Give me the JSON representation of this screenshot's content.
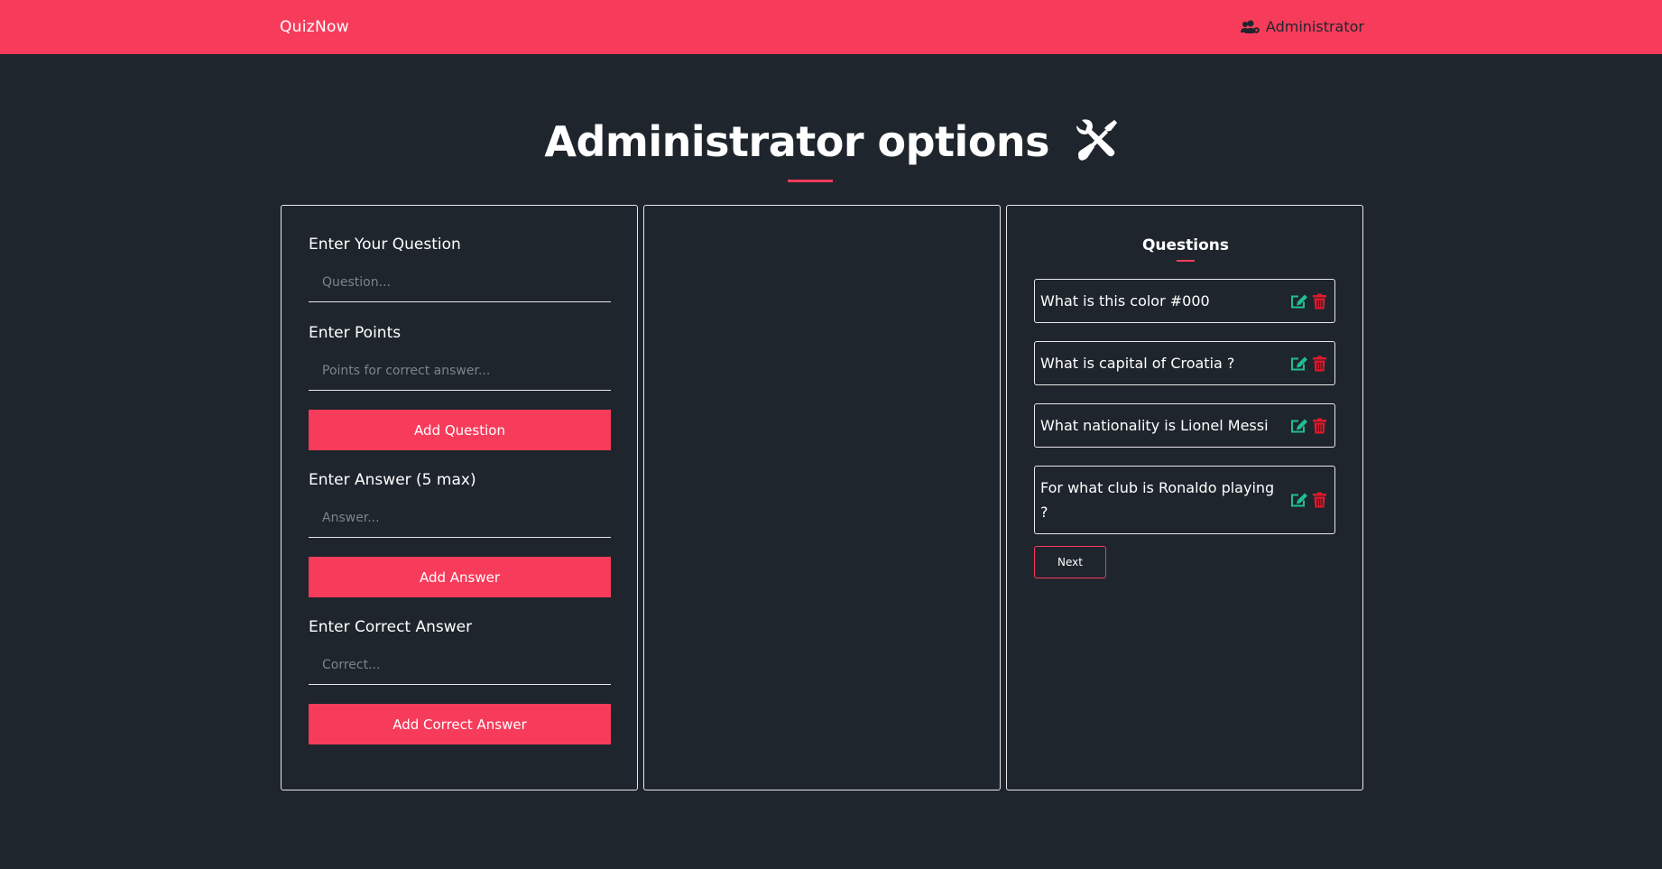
{
  "nav": {
    "brand": "QuizNow",
    "admin_label": "Administrator"
  },
  "page": {
    "title": "Administrator options"
  },
  "form": {
    "question_label": "Enter Your Question",
    "question_placeholder": "Question...",
    "points_label": "Enter Points",
    "points_placeholder": "Points for correct answer...",
    "add_question_label": "Add Question",
    "answer_label": "Enter Answer (5 max)",
    "answer_placeholder": "Answer...",
    "add_answer_label": "Add Answer",
    "correct_label": "Enter Correct Answer",
    "correct_placeholder": "Correct...",
    "add_correct_label": "Add Correct Answer"
  },
  "questions": {
    "heading": "Questions",
    "items": [
      {
        "text": "What is this color #000"
      },
      {
        "text": "What is capital of Croatia ?"
      },
      {
        "text": "What nationality is Lionel Messi"
      },
      {
        "text": "For what club is Ronaldo playing ?"
      }
    ],
    "next_label": "Next"
  },
  "colors": {
    "accent": "#f73c5b",
    "background": "#1f252d",
    "edit": "#1fbf8f",
    "delete": "#e3182d"
  },
  "icons": {
    "admin": "users-cog-icon",
    "title": "tools-icon",
    "edit": "edit-icon",
    "delete": "trash-icon"
  }
}
